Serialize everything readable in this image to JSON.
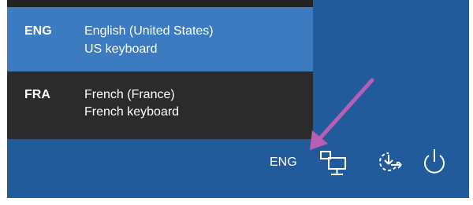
{
  "language_flyout": {
    "items": [
      {
        "code": "ENG",
        "name": "English (United States)",
        "keyboard": "US keyboard",
        "selected": true
      },
      {
        "code": "FRA",
        "name": "French (France)",
        "keyboard": "French keyboard",
        "selected": false
      }
    ]
  },
  "taskbar": {
    "language_indicator": "ENG",
    "icons": [
      "network-icon",
      "ease-of-access-icon",
      "power-icon"
    ]
  },
  "annotation": {
    "arrow_color": "#b75fb5"
  },
  "colors": {
    "background": "#225b9b",
    "selected_item": "#3d7bc0",
    "flyout": "#2b2b2b"
  }
}
